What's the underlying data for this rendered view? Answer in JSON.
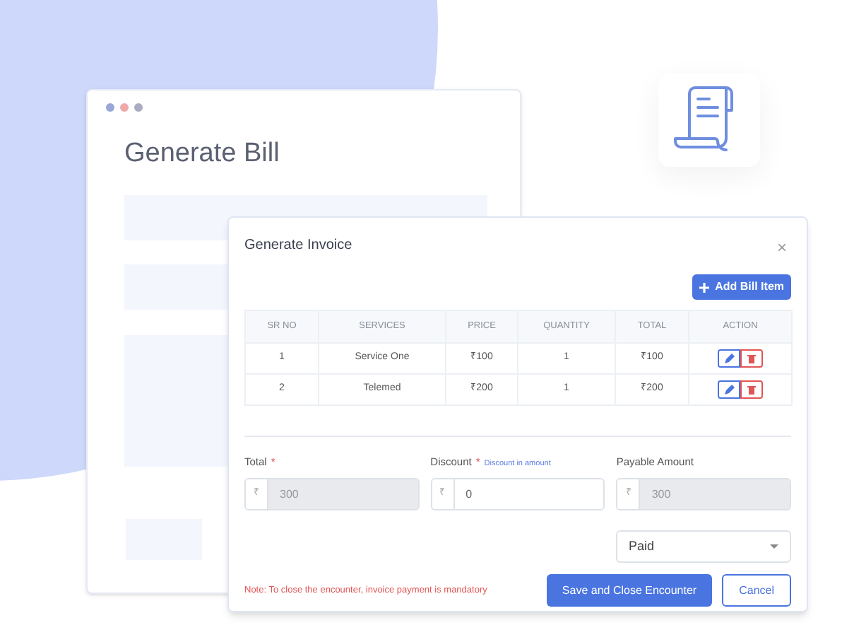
{
  "background_window": {
    "title": "Generate Bill"
  },
  "modal": {
    "title": "Generate Invoice",
    "close": "×",
    "add_button": "Add Bill Item",
    "table": {
      "columns": [
        "SR NO",
        "SERVICES",
        "PRICE",
        "QUANTITY",
        "TOTAL",
        "ACTION"
      ],
      "rows": [
        {
          "cells": [
            "1",
            "Service One",
            "₹100",
            "1",
            "₹100"
          ]
        },
        {
          "cells": [
            "2",
            "Telemed",
            "₹200",
            "1",
            "₹200"
          ]
        }
      ]
    },
    "fields": [
      {
        "label": "Total",
        "required_mark": "*",
        "prefix": "₹",
        "value": "300",
        "disabled": true
      },
      {
        "label": "Discount",
        "required_mark": "*",
        "hint": "Discount in amount",
        "prefix": "₹",
        "value": "0",
        "disabled": false
      },
      {
        "label": "Payable Amount",
        "prefix": "₹",
        "value": "300",
        "disabled": true
      }
    ],
    "status": {
      "value": "Paid"
    },
    "note": "Note: To close the encounter, invoice payment is mandatory",
    "buttons": [
      {
        "label": "Save and Close Encounter",
        "kind": "primary"
      },
      {
        "label": "Cancel",
        "kind": "outline"
      }
    ]
  }
}
